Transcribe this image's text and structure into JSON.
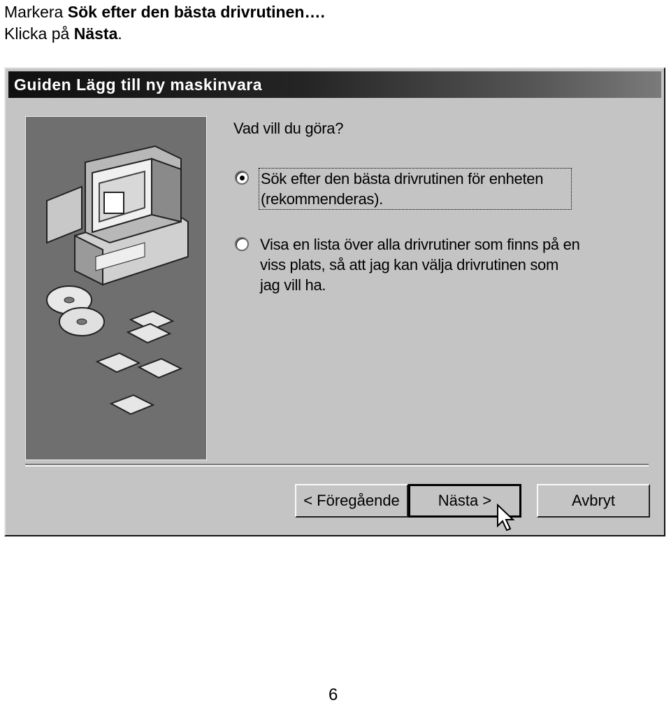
{
  "instructions": {
    "line1_prefix": "Markera ",
    "line1_bold": "Sök efter den bästa drivrutinen….",
    "line2_prefix": "Klicka på ",
    "line2_bold": "Nästa",
    "line2_suffix": "."
  },
  "dialog": {
    "title": "Guiden Lägg till ny maskinvara",
    "question": "Vad vill du göra?",
    "options": [
      {
        "label": "Sök efter den bästa drivrutinen för enheten (rekommenderas).",
        "selected": true
      },
      {
        "label": "Visa en lista över alla drivrutiner som finns på en viss plats, så att jag kan välja drivrutinen som jag vill ha.",
        "selected": false
      }
    ],
    "buttons": {
      "back": "< Föregående",
      "next": "Nästa >",
      "cancel": "Avbryt"
    },
    "illustration_icons": [
      "computer-icon",
      "cd-icon",
      "floppy-disk-icon"
    ]
  },
  "page_number": "6",
  "colors": {
    "dialog_bg": "#c4c4c4",
    "titlebar": "#101010",
    "sidepanel": "#6f6f6f"
  }
}
